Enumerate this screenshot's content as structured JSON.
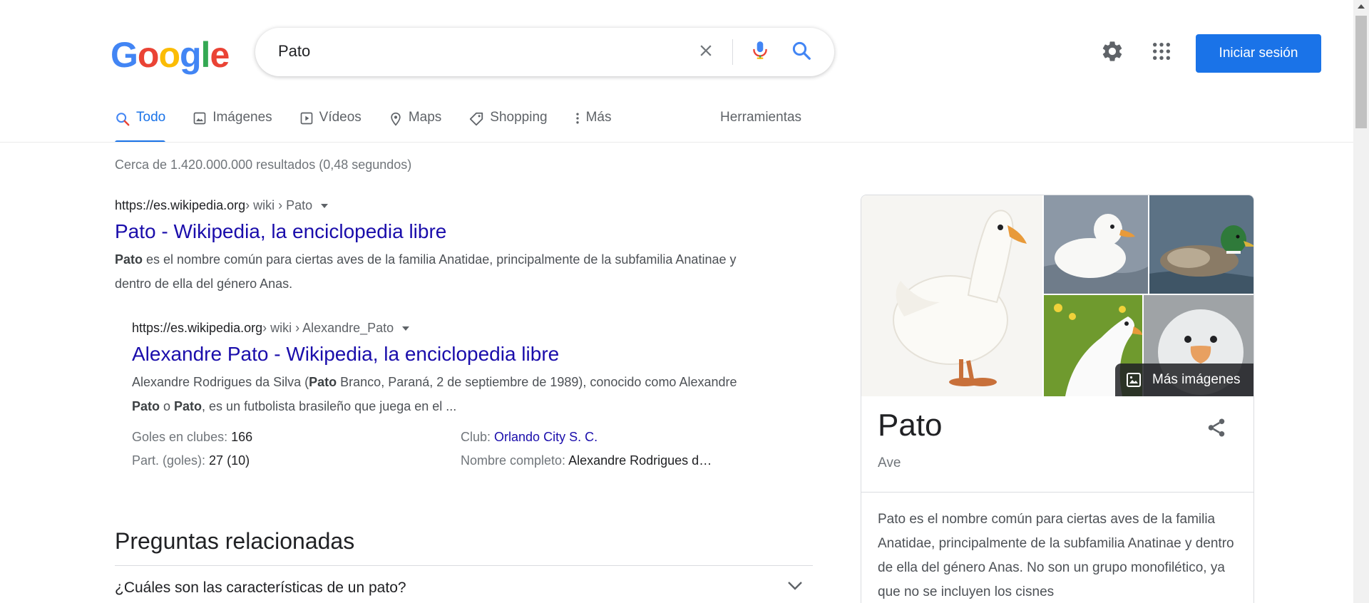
{
  "header": {
    "logo_letters": [
      {
        "char": "G",
        "color": "#4285F4"
      },
      {
        "char": "o",
        "color": "#EA4335"
      },
      {
        "char": "o",
        "color": "#FBBC05"
      },
      {
        "char": "g",
        "color": "#4285F4"
      },
      {
        "char": "l",
        "color": "#34A853"
      },
      {
        "char": "e",
        "color": "#EA4335"
      }
    ],
    "search_value": "Pato",
    "signin_label": "Iniciar sesión"
  },
  "tabs": [
    {
      "label": "Todo",
      "icon": "search-icon",
      "active": true
    },
    {
      "label": "Imágenes",
      "icon": "image-icon",
      "active": false
    },
    {
      "label": "Vídeos",
      "icon": "play-icon",
      "active": false
    },
    {
      "label": "Maps",
      "icon": "map-pin-icon",
      "active": false
    },
    {
      "label": "Shopping",
      "icon": "tag-icon",
      "active": false
    },
    {
      "label": "Más",
      "icon": "more-vertical-icon",
      "active": false
    }
  ],
  "tools_label": "Herramientas",
  "stats": "Cerca de 1.420.000.000 resultados (0,48 segundos)",
  "results": [
    {
      "url_domain": "https://es.wikipedia.org",
      "url_crumb": " › wiki › Pato",
      "title": "Pato - Wikipedia, la enciclopedia libre",
      "snippet_html": "<b>Pato</b> es el nombre común para ciertas aves de la familia Anatidae, principalmente de la subfamilia Anatinae y dentro de ella del género Anas."
    },
    {
      "url_domain": "https://es.wikipedia.org",
      "url_crumb": " › wiki › Alexandre_Pato",
      "title": "Alexandre Pato - Wikipedia, la enciclopedia libre",
      "snippet_html": "Alexandre Rodrigues da Silva (<b>Pato</b> Branco, Paraná, 2 de septiembre de 1989), conocido como Alexandre <b>Pato</b> o <b>Pato</b>, es un futbolista brasileño que juega en el ..."
    }
  ],
  "facts": {
    "goals_label": "Goles en clubes: ",
    "goals_value": "166",
    "apps_label": "Part. (goles): ",
    "apps_value": "27 (10)",
    "club_label": "Club: ",
    "club_value": "Orlando City S. C.",
    "fullname_label": "Nombre completo: ",
    "fullname_value": "Alexandre Rodrigues d…"
  },
  "paa": {
    "title": "Preguntas relacionadas",
    "question": "¿Cuáles son las características de un pato?"
  },
  "knowledge_panel": {
    "more_images_label": "Más imágenes",
    "title": "Pato",
    "subtitle": "Ave",
    "description": "Pato es el nombre común para ciertas aves de la familia Anatidae, principalmente de la subfamilia Anatinae y dentro de ella del género Anas. No son un grupo monofilético, ya que no se incluyen los cisnes"
  },
  "colors": {
    "accent": "#1a73e8",
    "link": "#1a0dab"
  }
}
